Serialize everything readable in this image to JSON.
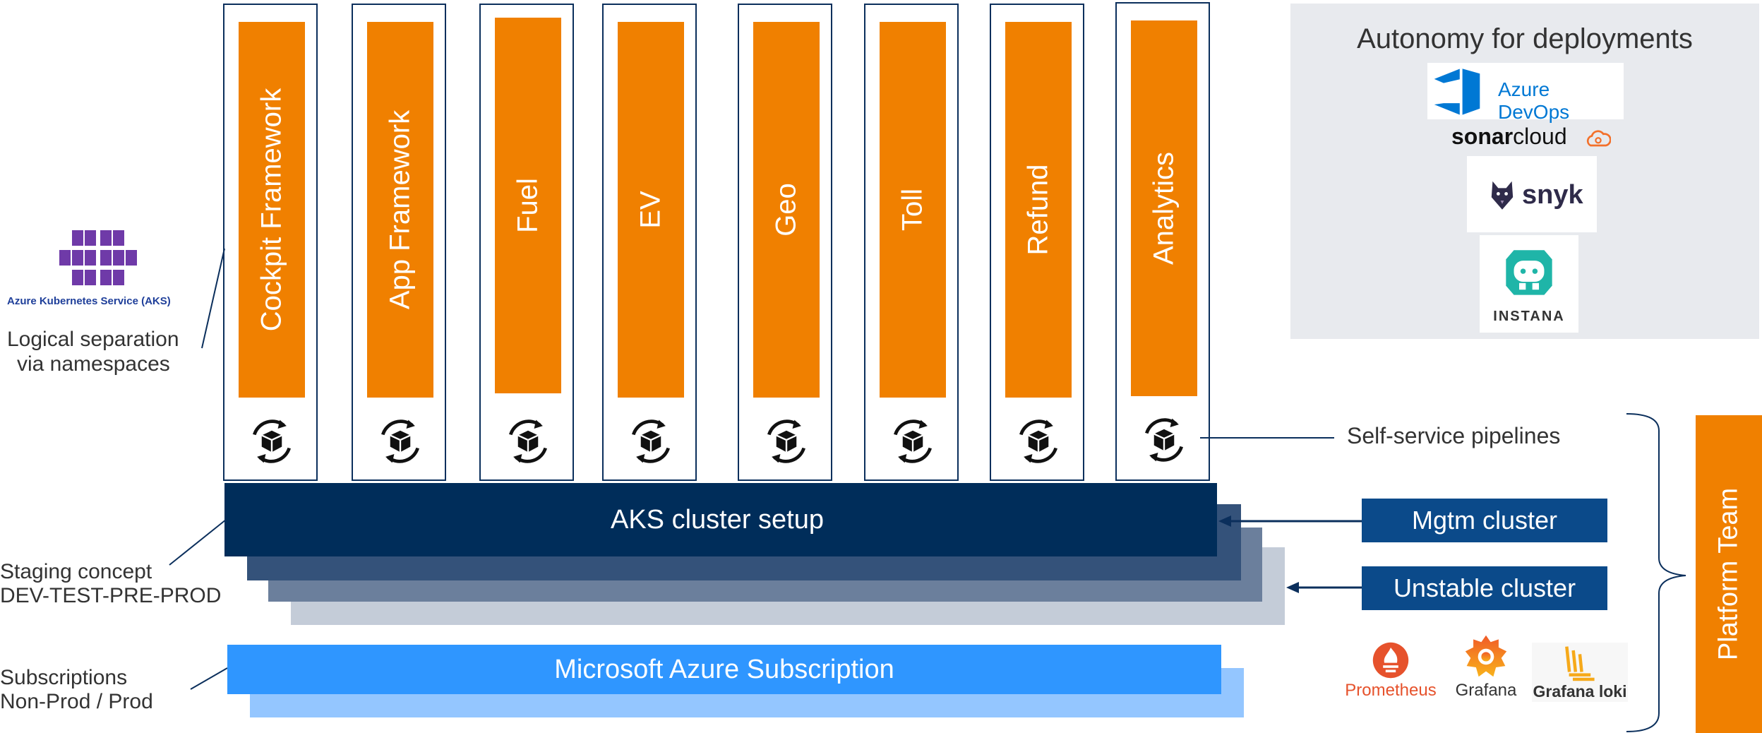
{
  "namespaces": [
    {
      "label": "Cockpit Framework"
    },
    {
      "label": "App Framework"
    },
    {
      "label": "Fuel"
    },
    {
      "label": "EV"
    },
    {
      "label": "Geo"
    },
    {
      "label": "Toll"
    },
    {
      "label": "Refund"
    },
    {
      "label": "Analytics"
    }
  ],
  "aks": {
    "logo_caption": "Azure Kubernetes Service (AKS)",
    "namespace_note_line1": "Logical separation",
    "namespace_note_line2": "via namespaces",
    "cluster_setup": "AKS cluster setup"
  },
  "staging": {
    "line1": "Staging concept",
    "line2": "DEV-TEST-PRE-PROD"
  },
  "subscription": {
    "label": "Microsoft Azure Subscription",
    "note_line1": "Subscriptions",
    "note_line2": "Non-Prod / Prod"
  },
  "autonomy": {
    "title": "Autonomy for deployments",
    "azure_devops": "Azure DevOps",
    "sonar_bold": "sonar",
    "sonar_light": "cloud",
    "snyk": "snyk",
    "instana": "INSTANA"
  },
  "pipelines_label": "Self-service pipelines",
  "clusters": {
    "mgmt": "Mgtm cluster",
    "unstable": "Unstable cluster"
  },
  "monitoring": {
    "prometheus": "Prometheus",
    "grafana": "Grafana",
    "loki": "Grafana loki"
  },
  "platform_team": "Platform Team",
  "colors": {
    "orange": "#f08000",
    "navy": "#002d5a",
    "azure": "#2f96ff",
    "cluster": "#0b4a8a"
  }
}
